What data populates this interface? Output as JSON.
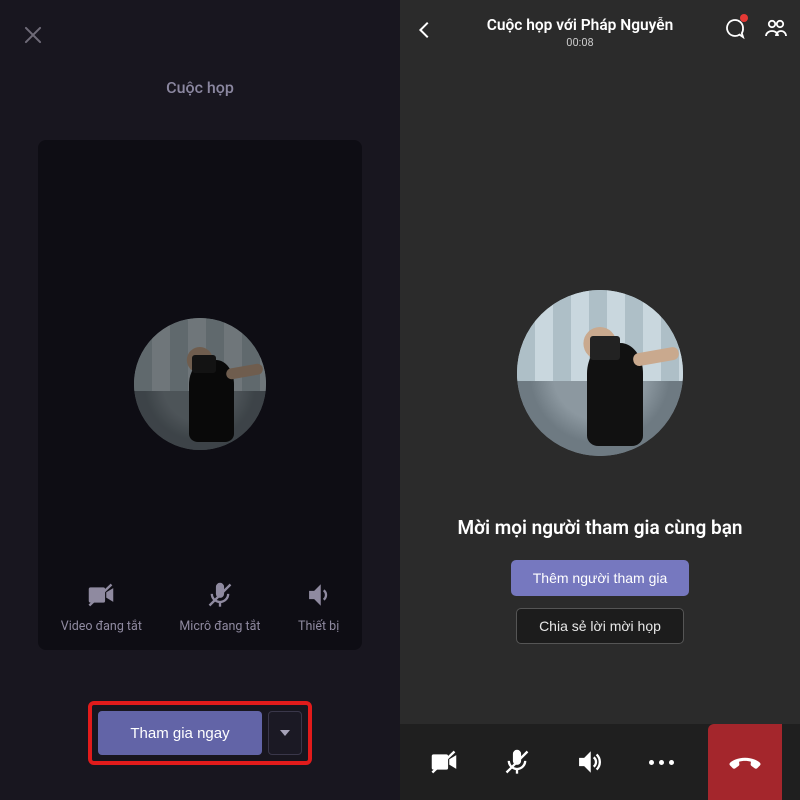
{
  "left": {
    "title": "Cuộc họp",
    "controls": {
      "video_off": "Video đang tắt",
      "mic_off": "Micrô đang tắt",
      "devices": "Thiết bị"
    },
    "join_button": "Tham gia ngay"
  },
  "right": {
    "header": {
      "title": "Cuộc họp với Pháp Nguyễn",
      "timer": "00:08"
    },
    "invite_headline": "Mời mọi người tham gia cùng bạn",
    "add_people": "Thêm người tham gia",
    "share_invite": "Chia sẻ lời mời họp"
  }
}
